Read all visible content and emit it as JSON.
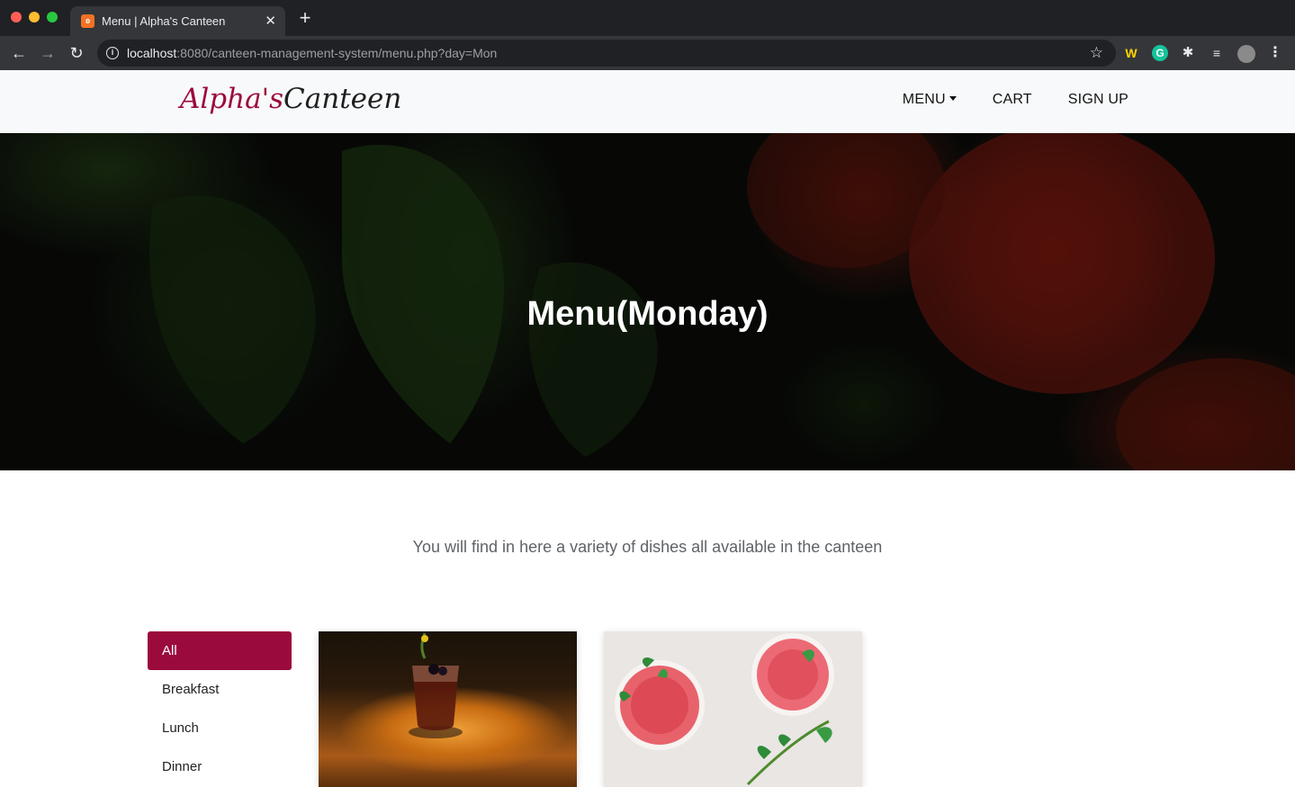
{
  "browser": {
    "tab_title": "Menu | Alpha's Canteen",
    "tab_favicon": "XAMPP",
    "url_host": "localhost",
    "url_path": ":8080/canteen-management-system/menu.php?day=Mon"
  },
  "site": {
    "logo_first": "Alpha's",
    "logo_second": "Canteen",
    "nav": {
      "menu": "MENU",
      "cart": "CART",
      "signup": "SIGN UP"
    },
    "accent_color": "#9b0a3d"
  },
  "hero": {
    "title": "Menu(Monday)"
  },
  "main": {
    "tagline": "You will find in here a variety of dishes all available in the canteen",
    "categories": [
      {
        "label": "All",
        "active": true
      },
      {
        "label": "Breakfast",
        "active": false
      },
      {
        "label": "Lunch",
        "active": false
      },
      {
        "label": "Dinner",
        "active": false
      }
    ]
  }
}
